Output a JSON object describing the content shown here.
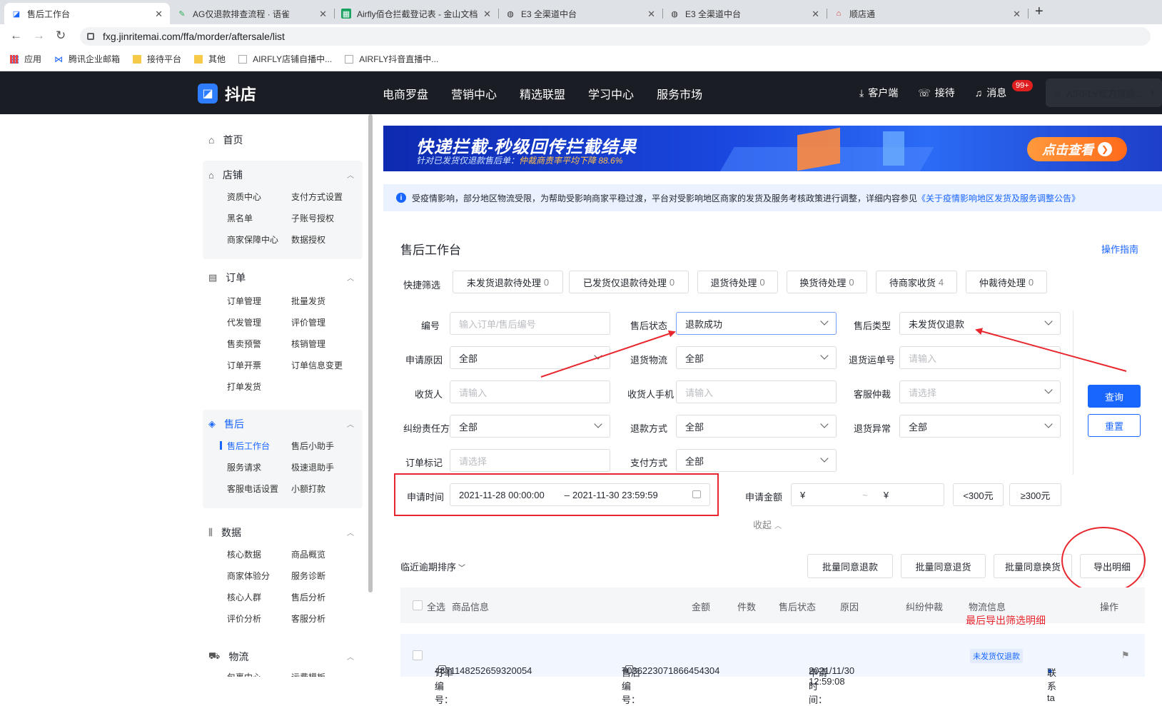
{
  "browser": {
    "tabs": [
      {
        "title": "售后工作台",
        "icon": "doudian-icon",
        "active": true
      },
      {
        "title": "AG仅退款排查流程 · 语雀",
        "icon": "yuque-icon",
        "active": false
      },
      {
        "title": "Airfly佰仓拦截登记表 - 金山文档",
        "icon": "sheet-icon",
        "active": false
      },
      {
        "title": "E3 全渠道中台",
        "icon": "globe-icon",
        "active": false
      },
      {
        "title": "E3 全渠道中台",
        "icon": "globe-icon",
        "active": false
      },
      {
        "title": "顺店通",
        "icon": "shop-icon",
        "active": false
      }
    ],
    "url": "fxg.jinritemai.com/ffa/morder/aftersale/list",
    "bookmarks": [
      "应用",
      "腾讯企业邮箱",
      "接待平台",
      "其他",
      "AIRFLY店铺自播中...",
      "AIRFLY抖音直播中..."
    ]
  },
  "topnav": {
    "brand": "抖店",
    "menu": [
      "电商罗盘",
      "营销中心",
      "精选联盟",
      "学习中心",
      "服务市场"
    ],
    "client": "客户端",
    "reception": "接待",
    "messages": "消息",
    "msg_badge": "99+",
    "user": "AIRFLY官方旗舰..."
  },
  "sidebar": {
    "home": "首页",
    "sections": [
      {
        "title": "店铺",
        "items": [
          "资质中心",
          "支付方式设置",
          "黑名单",
          "子账号授权",
          "商家保障中心",
          "数据授权"
        ]
      },
      {
        "title": "订单",
        "items": [
          "订单管理",
          "批量发货",
          "代发管理",
          "评价管理",
          "售卖预警",
          "核销管理",
          "订单开票",
          "订单信息变更",
          "打单发货"
        ]
      },
      {
        "title": "售后",
        "items": [
          "售后工作台",
          "售后小助手",
          "服务请求",
          "极速退助手",
          "客服电话设置",
          "小额打款"
        ]
      },
      {
        "title": "数据",
        "items": [
          "核心数据",
          "商品概览",
          "商家体验分",
          "服务诊断",
          "核心人群",
          "售后分析",
          "评价分析",
          "客服分析"
        ]
      },
      {
        "title": "物流",
        "items": [
          "包裹中心",
          "运费模板"
        ]
      }
    ]
  },
  "banner": {
    "title": "快递拦截-秒级回传拦截结果",
    "subtitle_prefix": "针对已发货仅退款售后单：",
    "subtitle_highlight": "仲裁商责率平均下降",
    "subtitle_value": "88.6%",
    "cta": "点击查看"
  },
  "notice": {
    "text": "受疫情影响，部分地区物流受限，为帮助受影响商家平稳过渡，平台对受影响地区商家的发货及服务考核政策进行调整，详细内容参见",
    "link": "《关于疫情影响地区发货及服务调整公告》"
  },
  "page": {
    "title": "售后工作台",
    "guide": "操作指南"
  },
  "quick_filter": {
    "label": "快捷筛选",
    "buttons": [
      {
        "label": "未发货退款待处理",
        "count": "0"
      },
      {
        "label": "已发货仅退款待处理",
        "count": "0"
      },
      {
        "label": "退货待处理",
        "count": "0"
      },
      {
        "label": "换货待处理",
        "count": "0"
      },
      {
        "label": "待商家收货",
        "count": "4"
      },
      {
        "label": "仲裁待处理",
        "count": "0"
      }
    ]
  },
  "filters": {
    "order_no": {
      "label": "编号",
      "placeholder": "输入订单/售后编号"
    },
    "status": {
      "label": "售后状态",
      "value": "退款成功"
    },
    "type": {
      "label": "售后类型",
      "value": "未发货仅退款"
    },
    "reason": {
      "label": "申请原因",
      "value": "全部"
    },
    "return_logistics": {
      "label": "退货物流",
      "value": "全部"
    },
    "return_waybill": {
      "label": "退货运单号",
      "placeholder": "请输入"
    },
    "receiver": {
      "label": "收货人",
      "placeholder": "请输入"
    },
    "receiver_phone": {
      "label": "收货人手机",
      "placeholder": "请输入"
    },
    "cs_arbitration": {
      "label": "客服仲裁",
      "placeholder": "请选择"
    },
    "dispute_party": {
      "label": "纠纷责任方",
      "value": "全部"
    },
    "refund_method": {
      "label": "退款方式",
      "value": "全部"
    },
    "return_exception": {
      "label": "退货异常",
      "value": "全部"
    },
    "order_mark": {
      "label": "订单标记",
      "placeholder": "请选择"
    },
    "payment": {
      "label": "支付方式",
      "value": "全部"
    },
    "apply_time": {
      "label": "申请时间",
      "start": "2021-11-28 00:00:00",
      "sep": "–",
      "end": "2021-11-30 23:59:59"
    },
    "amount": {
      "label": "申请金额",
      "currency1": "¥",
      "tilde": "~",
      "currency2": "¥",
      "lt": "<300元",
      "gte": "≥300元"
    },
    "query": "查询",
    "reset": "重置",
    "collapse": "收起"
  },
  "list": {
    "sort": "临近逾期排序",
    "batch_refund": "批量同意退款",
    "batch_return": "批量同意退货",
    "batch_exchange": "批量同意换货",
    "export": "导出明细",
    "columns": [
      "全选",
      "商品信息",
      "金额",
      "件数",
      "售后状态",
      "原因",
      "纠纷仲裁",
      "物流信息",
      "操作"
    ],
    "annotation": "最后导出筛选明细",
    "row": {
      "order_label": "订单编号：",
      "order_no": "4871148252659320054",
      "aftersale_label": "售后编号：",
      "aftersale_no": "7036223071866454304",
      "apply_label": "申请时间：",
      "apply_time": "2021/11/30 12:59:08",
      "tag": "未发货仅退款",
      "contact": "联系ta"
    }
  },
  "colors": {
    "accent": "#1966ff",
    "annotation_red": "#e8262d",
    "nav_bg": "#1a1d23"
  }
}
